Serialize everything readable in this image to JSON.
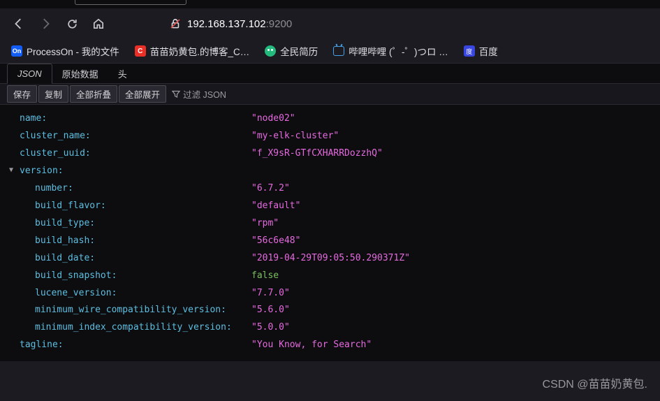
{
  "url": {
    "host": "192.168.137.102",
    "port": ":9200"
  },
  "bookmarks": {
    "processon": "ProcessOn - 我的文件",
    "csdn": "苗苗奶黄包.的博客_C…",
    "resume": "全民简历",
    "bilibili": "哔哩哔哩 (゜-゜)つロ …",
    "baidu": "百度"
  },
  "viewerTabs": {
    "json": "JSON",
    "raw": "原始数据",
    "headers": "头"
  },
  "toolbar": {
    "save": "保存",
    "copy": "复制",
    "collapse": "全部折叠",
    "expand": "全部展开",
    "filterPlaceholder": "过滤 JSON"
  },
  "json": {
    "name_k": "name",
    "name_v": "\"node02\"",
    "cluster_name_k": "cluster_name",
    "cluster_name_v": "\"my-elk-cluster\"",
    "cluster_uuid_k": "cluster_uuid",
    "cluster_uuid_v": "\"f_X9sR-GTfCXHARRDozzhQ\"",
    "version_k": "version",
    "number_k": "number",
    "number_v": "\"6.7.2\"",
    "build_flavor_k": "build_flavor",
    "build_flavor_v": "\"default\"",
    "build_type_k": "build_type",
    "build_type_v": "\"rpm\"",
    "build_hash_k": "build_hash",
    "build_hash_v": "\"56c6e48\"",
    "build_date_k": "build_date",
    "build_date_v": "\"2019-04-29T09:05:50.290371Z\"",
    "build_snapshot_k": "build_snapshot",
    "build_snapshot_v": "false",
    "lucene_version_k": "lucene_version",
    "lucene_version_v": "\"7.7.0\"",
    "mwcv_k": "minimum_wire_compatibility_version",
    "mwcv_v": "\"5.6.0\"",
    "micv_k": "minimum_index_compatibility_version",
    "micv_v": "\"5.0.0\"",
    "tagline_k": "tagline",
    "tagline_v": "\"You Know, for Search\""
  },
  "watermark": "CSDN @苗苗奶黄包."
}
